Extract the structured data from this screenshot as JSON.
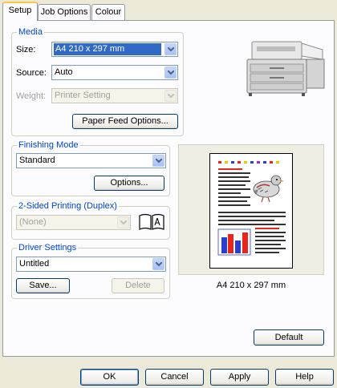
{
  "tabs": [
    {
      "label": "Setup",
      "active": true
    },
    {
      "label": "Job Options",
      "active": false
    },
    {
      "label": "Colour",
      "active": false
    }
  ],
  "media": {
    "title": "Media",
    "size_label": "Size:",
    "size_value": "A4 210 x 297 mm",
    "source_label": "Source:",
    "source_value": "Auto",
    "weight_label": "Weight:",
    "weight_value": "Printer Setting",
    "paper_feed_button": "Paper Feed Options..."
  },
  "finishing": {
    "title": "Finishing Mode",
    "value": "Standard",
    "options_button": "Options..."
  },
  "duplex": {
    "title": "2-Sided Printing (Duplex)",
    "value": "(None)"
  },
  "driver": {
    "title": "Driver Settings",
    "value": "Untitled",
    "save_button": "Save...",
    "delete_button": "Delete"
  },
  "preview": {
    "caption": "A4 210 x 297 mm"
  },
  "default_button": "Default",
  "footer": {
    "ok": "OK",
    "cancel": "Cancel",
    "apply": "Apply",
    "help": "Help"
  },
  "colors": {
    "accent": "#0046d5",
    "selection": "#316ac5",
    "tab_highlight": "#ffc83c"
  }
}
